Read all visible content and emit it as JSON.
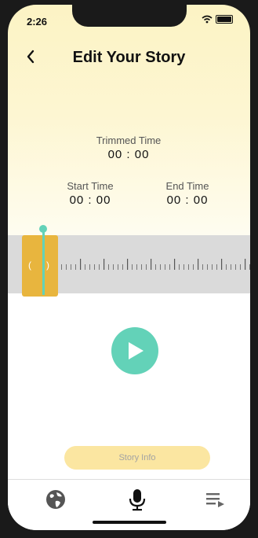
{
  "status_bar": {
    "time": "2:26"
  },
  "header": {
    "title": "Edit Your Story",
    "back_icon": "chevron-left-icon"
  },
  "trim": {
    "trimmed_label": "Trimmed Time",
    "trimmed_value": "00 : 00",
    "start_label": "Start Time",
    "start_value": "00 : 00",
    "end_label": "End Time",
    "end_value": "00 : 00"
  },
  "timeline": {
    "handle_left_glyph": "(",
    "handle_right_glyph": ")"
  },
  "player": {
    "play_icon": "play-icon"
  },
  "story_info_button": "Story Info",
  "tab_bar": {
    "items": [
      "globe-icon",
      "microphone-icon",
      "playlist-icon"
    ],
    "active": "microphone-icon"
  },
  "colors": {
    "accent_teal": "#63d2b8",
    "accent_yellow": "#e8b53e",
    "button_yellow": "#fbe6a1"
  }
}
